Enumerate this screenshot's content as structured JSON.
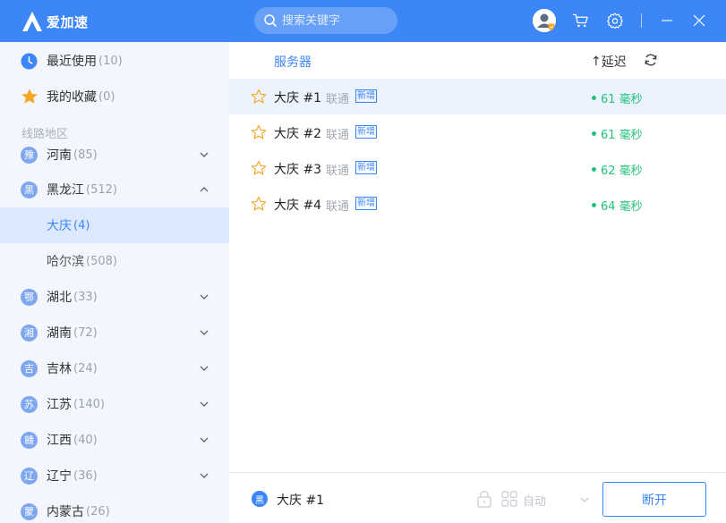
{
  "app": {
    "name": "爱加速",
    "search_placeholder": "搜索关键字"
  },
  "colors": {
    "brand": "#3d86f8",
    "latency_good": "#22c27a",
    "sidebar_bg": "#f3f7fd",
    "active_row": "#dce9fc"
  },
  "sidebar": {
    "recent": {
      "label": "最近使用",
      "count": "(10)",
      "icon": "clock-icon"
    },
    "favorites": {
      "label": "我的收藏",
      "count": "(0)",
      "icon": "star-icon"
    },
    "section_label": "线路地区",
    "regions": [
      {
        "badge": "豫",
        "label": "河南",
        "count": "(85)",
        "expanded": false
      },
      {
        "badge": "黑",
        "label": "黑龙江",
        "count": "(512)",
        "expanded": true
      },
      {
        "badge": "鄂",
        "label": "湖北",
        "count": "(33)",
        "expanded": false
      },
      {
        "badge": "湘",
        "label": "湖南",
        "count": "(72)",
        "expanded": false
      },
      {
        "badge": "吉",
        "label": "吉林",
        "count": "(24)",
        "expanded": false
      },
      {
        "badge": "苏",
        "label": "江苏",
        "count": "(140)",
        "expanded": false
      },
      {
        "badge": "赣",
        "label": "江西",
        "count": "(40)",
        "expanded": false
      },
      {
        "badge": "辽",
        "label": "辽宁",
        "count": "(36)",
        "expanded": false
      },
      {
        "badge": "蒙",
        "label": "内蒙古",
        "count": "(26)",
        "expanded": false
      }
    ],
    "subregions": [
      {
        "label": "大庆",
        "count": "(4)",
        "active": true
      },
      {
        "label": "哈尔滨",
        "count": "(508)",
        "active": false
      }
    ]
  },
  "server_list": {
    "col_server": "服务器",
    "col_latency": "延迟",
    "sort_arrow": "↑",
    "rows": [
      {
        "name": "大庆 #1",
        "isp": "联通",
        "tag": "新增",
        "latency": "61 毫秒",
        "selected": true
      },
      {
        "name": "大庆 #2",
        "isp": "联通",
        "tag": "新增",
        "latency": "61 毫秒",
        "selected": false
      },
      {
        "name": "大庆 #3",
        "isp": "联通",
        "tag": "新增",
        "latency": "62 毫秒",
        "selected": false
      },
      {
        "name": "大庆 #4",
        "isp": "联通",
        "tag": "新增",
        "latency": "64 毫秒",
        "selected": false
      }
    ]
  },
  "bottom": {
    "conn_badge": "黑",
    "conn_name": "大庆 #1",
    "mode_label": "自动",
    "disconnect_label": "断开"
  }
}
